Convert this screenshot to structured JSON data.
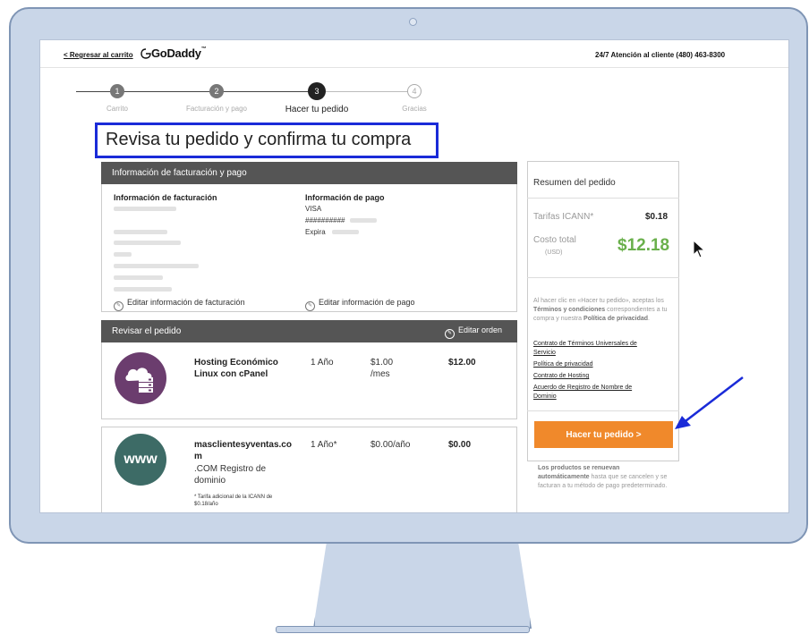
{
  "header": {
    "back_link": "< Regresar al carrito",
    "logo": "GoDaddy",
    "logo_tm": "™",
    "support": "24/7 Atención al cliente  (480) 463-8300"
  },
  "steps": [
    {
      "num": "1",
      "label": "Carrito"
    },
    {
      "num": "2",
      "label": "Facturación y pago"
    },
    {
      "num": "3",
      "label": "Hacer tu pedido"
    },
    {
      "num": "4",
      "label": "Gracias"
    }
  ],
  "page_title": "Revisa tu pedido y confirma tu compra",
  "billing": {
    "section_title": "Información de facturación y pago",
    "billing_info_label": "Información de facturación",
    "payment_info_label": "Información de pago",
    "card_type": "VISA",
    "card_number": "##########",
    "expires_label": "Expira",
    "edit_billing": "Editar información de facturación",
    "edit_payment": "Editar información de pago"
  },
  "review": {
    "section_title": "Revisar el pedido",
    "edit_order": "Editar orden",
    "items": [
      {
        "name_line1": "Hosting Económico",
        "name_line2": "Linux con cPanel",
        "term": "1 Año",
        "price_line1": "$1.00",
        "price_line2": "/mes",
        "total": "$12.00"
      },
      {
        "name_line1": "masclientesyventas.co",
        "name_line2": "m",
        "sub_line1": ".COM Registro de",
        "sub_line2": "dominio",
        "note_line1": "* Tarifa adicional de la ICANN de",
        "note_line2": "$0.18/año",
        "term": "1 Año*",
        "price": "$0.00/año",
        "total": "$0.00",
        "icon_text": "www"
      }
    ]
  },
  "summary": {
    "title": "Resumen del pedido",
    "icann_label": "Tarifas ICANN*",
    "icann_value": "$0.18",
    "total_label": "Costo total",
    "total_currency": "(USD)",
    "total_value": "$12.18",
    "legal_text": "Al hacer clic en «Hacer tu pedido», aceptas los",
    "legal_terms": "Términos y condiciones",
    "legal_text2": "correspondientes a tu compra y nuestra",
    "legal_privacy": "Política de privacidad",
    "links": [
      "Contrato de Términos Universales de",
      "Servicio",
      "Política de privacidad",
      "Contrato de Hosting",
      "Acuerdo de Registro de Nombre de",
      "Dominio"
    ],
    "order_button": "Hacer tu pedido >",
    "renew_bold1": "Los productos se renuevan",
    "renew_bold2": "automáticamente",
    "renew_text": "hasta que se cancelen y se facturan a tu método de pago predeterminado."
  },
  "colors": {
    "accent_blue": "#1a2bd8",
    "order_orange": "#f0892b",
    "total_green": "#6ab04c",
    "hosting_purple": "#6b3d6e",
    "www_teal": "#3d6b66"
  }
}
